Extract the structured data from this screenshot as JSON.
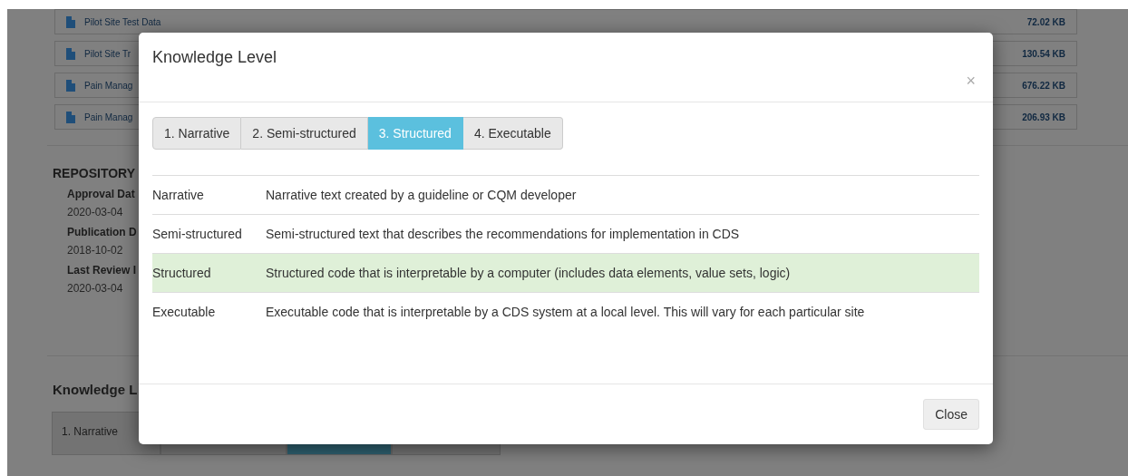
{
  "background_page": {
    "files": [
      {
        "name": "Pilot Site Test Data",
        "size": "72.02 KB"
      },
      {
        "name": "Pilot Site Tr",
        "size": "130.54 KB"
      },
      {
        "name": "Pain Manag",
        "size": "676.22 KB"
      },
      {
        "name": "Pain Manag",
        "size": "206.93 KB"
      }
    ],
    "repository": {
      "heading": "REPOSITORY",
      "fields": [
        {
          "label": "Approval Dat",
          "value": "2020-03-04"
        },
        {
          "label": "Publication D",
          "value": "2018-10-02"
        },
        {
          "label": "Last Review I",
          "value": "2020-03-04"
        }
      ]
    },
    "knowledge_heading": "Knowledge L",
    "tabs": [
      {
        "label": "1. Narrative",
        "selected": false
      },
      {
        "selected": false
      },
      {
        "selected": true
      },
      {
        "selected": false
      }
    ]
  },
  "modal": {
    "title": "Knowledge Level",
    "close_icon": "×",
    "tabs": [
      {
        "label": "1. Narrative",
        "selected": false
      },
      {
        "label": "2. Semi-structured",
        "selected": false
      },
      {
        "label": "3. Structured",
        "selected": true
      },
      {
        "label": "4. Executable",
        "selected": false
      }
    ],
    "rows": [
      {
        "level": "Narrative",
        "description": "Narrative text created by a guideline or CQM developer",
        "selected": false
      },
      {
        "level": "Semi-structured",
        "description": "Semi-structured text that describes the recommendations for implementation in CDS",
        "selected": false
      },
      {
        "level": "Structured",
        "description": "Structured code that is interpretable by a computer (includes data elements, value sets, logic)",
        "selected": true
      },
      {
        "level": "Executable",
        "description": "Executable code that is interpretable by a CDS system at a local level. This will vary for each particular site",
        "selected": false
      }
    ],
    "close_button": "Close"
  }
}
